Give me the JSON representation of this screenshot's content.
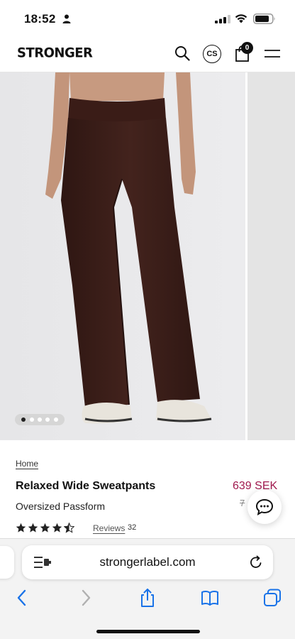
{
  "status_bar": {
    "time": "18:52"
  },
  "header": {
    "brand": "STRONGER",
    "currency": "CS",
    "cart_count": "0"
  },
  "gallery": {
    "slide_count": 5,
    "active_slide": 1
  },
  "product": {
    "breadcrumb": "Home",
    "title": "Relaxed Wide Sweatpants",
    "subtitle": "Oversized Passform",
    "price": "639 SEK",
    "old_price": "7",
    "rating": 4.5,
    "reviews_label": "Reviews",
    "reviews_count": "32"
  },
  "browser": {
    "url": "strongerlabel.com"
  },
  "colors": {
    "price_accent": "#a01a4e",
    "pants": "#3b1f1a"
  }
}
